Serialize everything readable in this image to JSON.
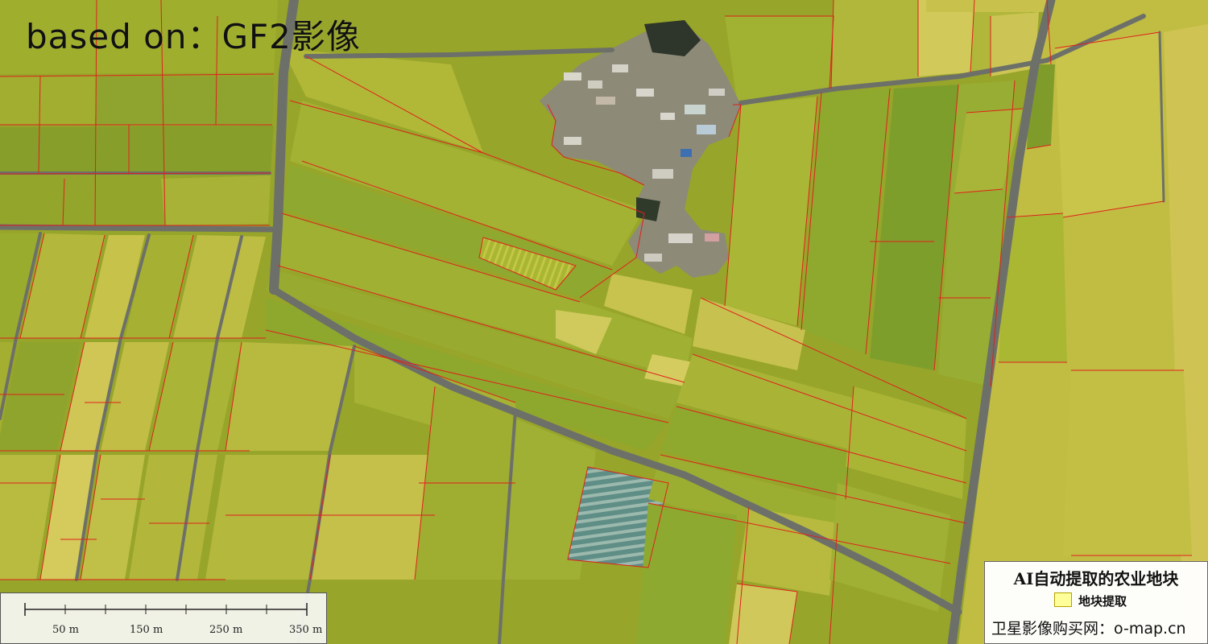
{
  "map": {
    "title": "based on：GF2影像",
    "scale_bar": {
      "labels": [
        "50 m",
        "150 m",
        "250 m",
        "350 m"
      ]
    },
    "legend": {
      "title": "AI自动提取的农业地块",
      "item_label": "地块提取",
      "item_color": "#ffff99",
      "footer": "卫星影像购买网：o-map.cn"
    },
    "colors": {
      "field_outline": "#e0201c",
      "road": "#6d7069",
      "village": "#8d8a78"
    }
  }
}
